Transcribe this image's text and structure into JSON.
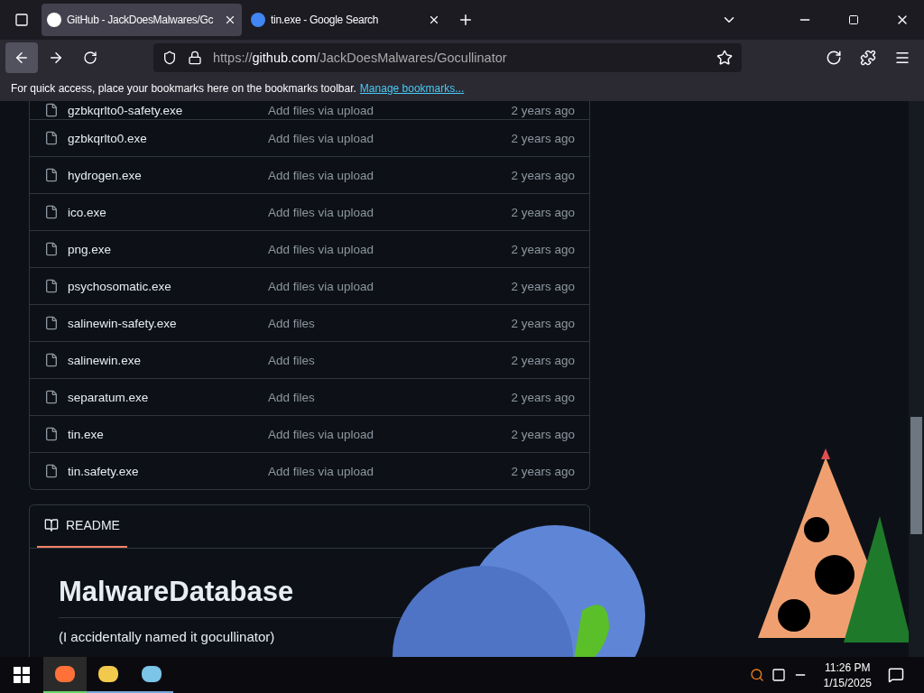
{
  "browser": {
    "tabs": [
      {
        "title": "GitHub - JackDoesMalwares/Gc",
        "selected": true,
        "kind": "github"
      },
      {
        "title": "tin.exe - Google Search",
        "selected": false,
        "kind": "google"
      }
    ],
    "url_prefix": "https://",
    "url_host": "github.com",
    "url_path": "/JackDoesMalwares/Gocullinator",
    "bookmarks_hint": "For quick access, place your bookmarks here on the bookmarks toolbar.",
    "bookmarks_link": "Manage bookmarks..."
  },
  "files": [
    {
      "name": "gzbkqrlto0-safety.exe",
      "message": "Add files via upload",
      "time": "2 years ago"
    },
    {
      "name": "gzbkqrlto0.exe",
      "message": "Add files via upload",
      "time": "2 years ago"
    },
    {
      "name": "hydrogen.exe",
      "message": "Add files via upload",
      "time": "2 years ago"
    },
    {
      "name": "ico.exe",
      "message": "Add files via upload",
      "time": "2 years ago"
    },
    {
      "name": "png.exe",
      "message": "Add files via upload",
      "time": "2 years ago"
    },
    {
      "name": "psychosomatic.exe",
      "message": "Add files via upload",
      "time": "2 years ago"
    },
    {
      "name": "salinewin-safety.exe",
      "message": "Add files",
      "time": "2 years ago"
    },
    {
      "name": "salinewin.exe",
      "message": "Add files",
      "time": "2 years ago"
    },
    {
      "name": "separatum.exe",
      "message": "Add files",
      "time": "2 years ago"
    },
    {
      "name": "tin.exe",
      "message": "Add files via upload",
      "time": "2 years ago"
    },
    {
      "name": "tin.safety.exe",
      "message": "Add files via upload",
      "time": "2 years ago"
    }
  ],
  "readme": {
    "tab": "README",
    "heading": "MalwareDatabase",
    "paragraph": "(I accidentally named it gocullinator)"
  },
  "taskbar": {
    "apps": [
      {
        "kind": "firefox",
        "selected": true
      },
      {
        "kind": "folder",
        "selected": false
      },
      {
        "kind": "paint",
        "selected": false
      }
    ],
    "time": "11:26 PM",
    "date": "1/15/2025"
  }
}
